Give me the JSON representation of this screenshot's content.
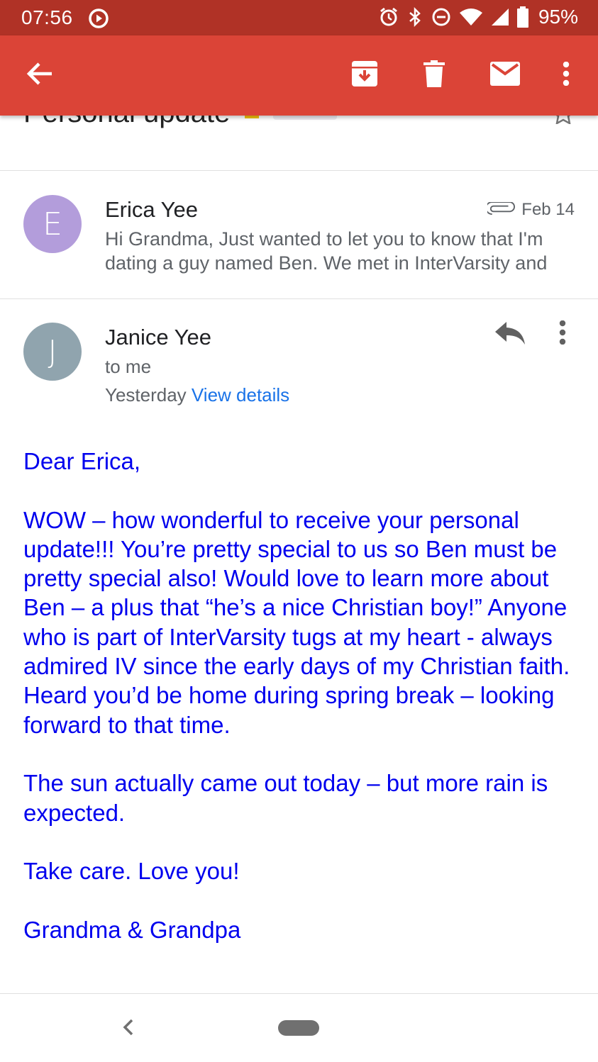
{
  "status_bar": {
    "time": "07:56",
    "battery": "95%",
    "icons": [
      "play-notification-icon",
      "alarm-icon",
      "bluetooth-icon",
      "do-not-disturb-icon",
      "wifi-icon",
      "signal-icon",
      "battery-icon"
    ]
  },
  "toolbar": {
    "actions": [
      "back-arrow-icon",
      "archive-icon",
      "delete-icon",
      "mark-unread-icon",
      "more-vert-icon"
    ],
    "color": "#db4437"
  },
  "subject": {
    "text": "Personal update"
  },
  "messages": [
    {
      "avatar_letter": "E",
      "avatar_color": "#b39ddb",
      "sender": "Erica Yee",
      "date": "Feb 14",
      "snippet": "Hi Grandma, Just wanted to let you to know that I'm dating a guy named Ben. We met in InterVarsity and"
    },
    {
      "avatar_letter": "J",
      "avatar_color": "#90a4ae",
      "sender": "Janice Yee",
      "recipient": "to me",
      "when": "Yesterday",
      "view_details": "View details",
      "body": [
        "Dear Erica,",
        "WOW – how wonderful to receive your personal update!!!  You’re pretty special to us so Ben must be pretty special also!  Would love to learn more about Ben – a plus that “he’s a nice Christian boy!”  Anyone who is part of InterVarsity tugs at my heart - always admired IV since the early days of my Christian faith.   Heard you’d be home during spring break – looking forward to that time.",
        "The sun actually came out today – but more rain is expected.",
        "Take care.  Love you!",
        "Grandma & Grandpa"
      ]
    }
  ],
  "colors": {
    "status_bar": "#b03226",
    "link": "#1a73e8",
    "body_text": "#0000ee"
  }
}
